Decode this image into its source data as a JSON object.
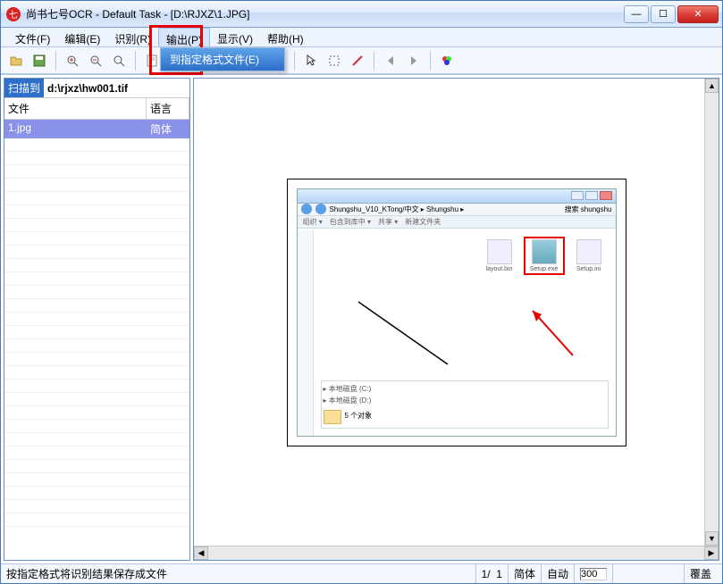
{
  "window": {
    "title": "尚书七号OCR - Default Task - [D:\\RJXZ\\1.JPG]"
  },
  "menubar": {
    "items": [
      "文件(F)",
      "编辑(E)",
      "识别(R)",
      "输出(P)",
      "显示(V)",
      "帮助(H)"
    ],
    "active_index": 3
  },
  "dropdown": {
    "item": "到指定格式文件(E)"
  },
  "sidebar": {
    "scan_label": "扫描到",
    "scan_path": "d:\\rjxz\\hw001.tif",
    "col_file": "文件",
    "col_lang": "语言",
    "row_file": "1.jpg",
    "row_lang": "简体"
  },
  "embedded": {
    "addr_path": "Shungshu_V10_KTong/中文 ▸ Shungshu ▸",
    "search_ph": "搜索 shungshu",
    "tool1": "组织 ▾",
    "tool2": "包含到库中 ▾",
    "tool3": "共享 ▾",
    "tool4": "新建文件夹",
    "icon1": "layout.bin",
    "icon2": "Setup.exe",
    "icon3": "Setup.ini",
    "tree1": "▸ 本地磁盘 (C:)",
    "tree2": "▸ 本地磁盘 (D:)",
    "tree3": "5 个对象"
  },
  "statusbar": {
    "message": "按指定格式将识别结果保存成文件",
    "page_current": "1/",
    "page_total": "1",
    "mode1": "简体",
    "mode2": "自动",
    "dpi": "300",
    "overwrite": "覆盖"
  },
  "toolbar_icons": [
    "open-icon",
    "save-icon",
    "zoom-in-icon",
    "zoom-out-icon",
    "zoom-fit-icon",
    "sep",
    "doc-icon",
    "doc2-icon",
    "run-icon",
    "sep",
    "filter-icon",
    "filter2-icon",
    "batch-icon",
    "sep",
    "pointer-icon",
    "region-icon",
    "pen-icon",
    "sep",
    "prev-icon",
    "next-icon",
    "sep",
    "color-icon"
  ]
}
